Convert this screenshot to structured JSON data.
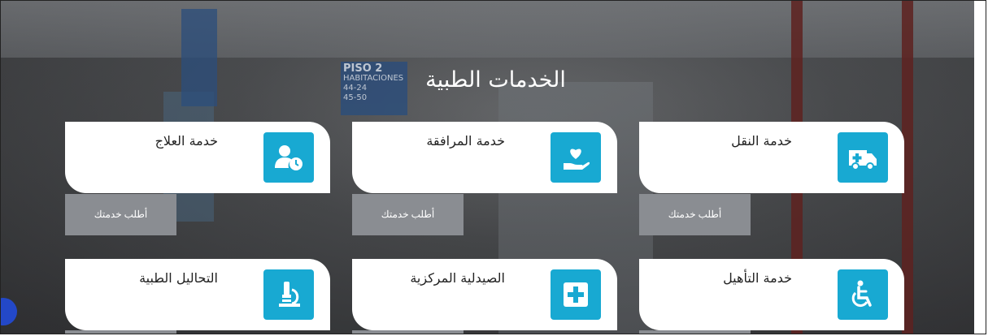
{
  "section_title": "الخدمات الطبية",
  "signage": {
    "piso": "PISO 2",
    "habitaciones": "HABITACIONES",
    "range_a": "44-24",
    "range_b": "45-50"
  },
  "cards": [
    {
      "label": "خدمة العلاج",
      "icon": "patient-clock-icon",
      "button": "أطلب خدمتك"
    },
    {
      "label": "خدمة المرافقة",
      "icon": "hand-heart-icon",
      "button": "أطلب خدمتك"
    },
    {
      "label": "خدمة النقل",
      "icon": "ambulance-icon",
      "button": "أطلب خدمتك"
    },
    {
      "label": "التحاليل الطبية",
      "icon": "microscope-icon"
    },
    {
      "label": "الصيدلية المركزية",
      "icon": "medical-cross-icon"
    },
    {
      "label": "خدمة التأهيل",
      "icon": "wheelchair-icon"
    }
  ],
  "colors": {
    "accent": "#18a9d2",
    "button_bg": "#8a8d92",
    "card_bg": "#ffffff"
  }
}
